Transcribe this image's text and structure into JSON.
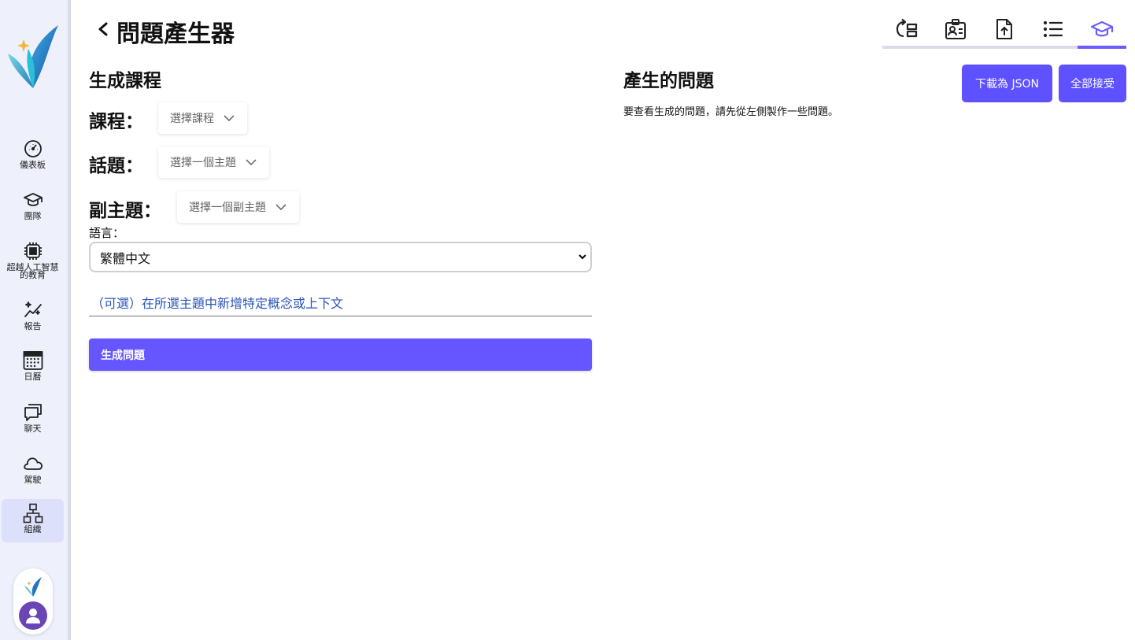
{
  "app": {
    "title": "問題產生器"
  },
  "sidebar": {
    "items": [
      {
        "label": "儀表板",
        "icon": "dashboard-gauge-icon"
      },
      {
        "label": "團隊",
        "icon": "graduation-cap-icon"
      },
      {
        "label": "超越人工智慧的教育",
        "icon": "chip-icon"
      },
      {
        "label": "報告",
        "icon": "sparkles-icon"
      },
      {
        "label": "日曆",
        "icon": "calendar-icon"
      },
      {
        "label": "聊天",
        "icon": "chat-icon"
      },
      {
        "label": "駕駛",
        "icon": "cloud-icon"
      },
      {
        "label": "組織",
        "icon": "org-chart-icon",
        "active": true
      }
    ]
  },
  "toolbar": {
    "tools": [
      {
        "icon": "refresh-layout-icon"
      },
      {
        "icon": "id-card-icon"
      },
      {
        "icon": "file-upload-icon"
      },
      {
        "icon": "list-icon"
      },
      {
        "icon": "graduation-cap-icon",
        "active": true
      }
    ],
    "accent": "#6b5cff"
  },
  "form": {
    "section_title": "生成課程",
    "course_label": "課程：",
    "course_placeholder": "選擇課程",
    "topic_label": "話題：",
    "topic_placeholder": "選擇一個主題",
    "subtopic_label": "副主題：",
    "subtopic_placeholder": "選擇一個副主題",
    "language_label": "語言：",
    "language_value": "繁體中文",
    "context_placeholder": "（可選）在所選主題中新增特定概念或上下文",
    "generate_label": "生成問題"
  },
  "results": {
    "title": "產生的問題",
    "hint": "要查看生成的問題，請先從左側製作一些問題。",
    "download_label": "下載為 JSON",
    "accept_all_label": "全部接受"
  },
  "colors": {
    "primary": "#6556ff",
    "sidebar_bg": "#eef0fb",
    "avatar": "#6a45b5"
  }
}
